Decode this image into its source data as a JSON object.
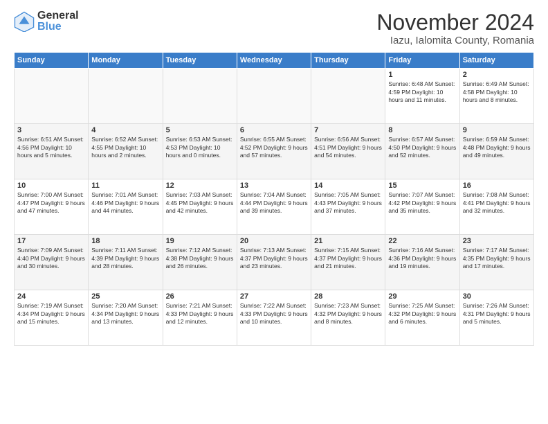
{
  "logo": {
    "general": "General",
    "blue": "Blue"
  },
  "title": "November 2024",
  "subtitle": "Iazu, Ialomita County, Romania",
  "calendar": {
    "headers": [
      "Sunday",
      "Monday",
      "Tuesday",
      "Wednesday",
      "Thursday",
      "Friday",
      "Saturday"
    ],
    "weeks": [
      [
        {
          "day": "",
          "info": ""
        },
        {
          "day": "",
          "info": ""
        },
        {
          "day": "",
          "info": ""
        },
        {
          "day": "",
          "info": ""
        },
        {
          "day": "",
          "info": ""
        },
        {
          "day": "1",
          "info": "Sunrise: 6:48 AM\nSunset: 4:59 PM\nDaylight: 10 hours and 11 minutes."
        },
        {
          "day": "2",
          "info": "Sunrise: 6:49 AM\nSunset: 4:58 PM\nDaylight: 10 hours and 8 minutes."
        }
      ],
      [
        {
          "day": "3",
          "info": "Sunrise: 6:51 AM\nSunset: 4:56 PM\nDaylight: 10 hours and 5 minutes."
        },
        {
          "day": "4",
          "info": "Sunrise: 6:52 AM\nSunset: 4:55 PM\nDaylight: 10 hours and 2 minutes."
        },
        {
          "day": "5",
          "info": "Sunrise: 6:53 AM\nSunset: 4:53 PM\nDaylight: 10 hours and 0 minutes."
        },
        {
          "day": "6",
          "info": "Sunrise: 6:55 AM\nSunset: 4:52 PM\nDaylight: 9 hours and 57 minutes."
        },
        {
          "day": "7",
          "info": "Sunrise: 6:56 AM\nSunset: 4:51 PM\nDaylight: 9 hours and 54 minutes."
        },
        {
          "day": "8",
          "info": "Sunrise: 6:57 AM\nSunset: 4:50 PM\nDaylight: 9 hours and 52 minutes."
        },
        {
          "day": "9",
          "info": "Sunrise: 6:59 AM\nSunset: 4:48 PM\nDaylight: 9 hours and 49 minutes."
        }
      ],
      [
        {
          "day": "10",
          "info": "Sunrise: 7:00 AM\nSunset: 4:47 PM\nDaylight: 9 hours and 47 minutes."
        },
        {
          "day": "11",
          "info": "Sunrise: 7:01 AM\nSunset: 4:46 PM\nDaylight: 9 hours and 44 minutes."
        },
        {
          "day": "12",
          "info": "Sunrise: 7:03 AM\nSunset: 4:45 PM\nDaylight: 9 hours and 42 minutes."
        },
        {
          "day": "13",
          "info": "Sunrise: 7:04 AM\nSunset: 4:44 PM\nDaylight: 9 hours and 39 minutes."
        },
        {
          "day": "14",
          "info": "Sunrise: 7:05 AM\nSunset: 4:43 PM\nDaylight: 9 hours and 37 minutes."
        },
        {
          "day": "15",
          "info": "Sunrise: 7:07 AM\nSunset: 4:42 PM\nDaylight: 9 hours and 35 minutes."
        },
        {
          "day": "16",
          "info": "Sunrise: 7:08 AM\nSunset: 4:41 PM\nDaylight: 9 hours and 32 minutes."
        }
      ],
      [
        {
          "day": "17",
          "info": "Sunrise: 7:09 AM\nSunset: 4:40 PM\nDaylight: 9 hours and 30 minutes."
        },
        {
          "day": "18",
          "info": "Sunrise: 7:11 AM\nSunset: 4:39 PM\nDaylight: 9 hours and 28 minutes."
        },
        {
          "day": "19",
          "info": "Sunrise: 7:12 AM\nSunset: 4:38 PM\nDaylight: 9 hours and 26 minutes."
        },
        {
          "day": "20",
          "info": "Sunrise: 7:13 AM\nSunset: 4:37 PM\nDaylight: 9 hours and 23 minutes."
        },
        {
          "day": "21",
          "info": "Sunrise: 7:15 AM\nSunset: 4:37 PM\nDaylight: 9 hours and 21 minutes."
        },
        {
          "day": "22",
          "info": "Sunrise: 7:16 AM\nSunset: 4:36 PM\nDaylight: 9 hours and 19 minutes."
        },
        {
          "day": "23",
          "info": "Sunrise: 7:17 AM\nSunset: 4:35 PM\nDaylight: 9 hours and 17 minutes."
        }
      ],
      [
        {
          "day": "24",
          "info": "Sunrise: 7:19 AM\nSunset: 4:34 PM\nDaylight: 9 hours and 15 minutes."
        },
        {
          "day": "25",
          "info": "Sunrise: 7:20 AM\nSunset: 4:34 PM\nDaylight: 9 hours and 13 minutes."
        },
        {
          "day": "26",
          "info": "Sunrise: 7:21 AM\nSunset: 4:33 PM\nDaylight: 9 hours and 12 minutes."
        },
        {
          "day": "27",
          "info": "Sunrise: 7:22 AM\nSunset: 4:33 PM\nDaylight: 9 hours and 10 minutes."
        },
        {
          "day": "28",
          "info": "Sunrise: 7:23 AM\nSunset: 4:32 PM\nDaylight: 9 hours and 8 minutes."
        },
        {
          "day": "29",
          "info": "Sunrise: 7:25 AM\nSunset: 4:32 PM\nDaylight: 9 hours and 6 minutes."
        },
        {
          "day": "30",
          "info": "Sunrise: 7:26 AM\nSunset: 4:31 PM\nDaylight: 9 hours and 5 minutes."
        }
      ]
    ]
  }
}
